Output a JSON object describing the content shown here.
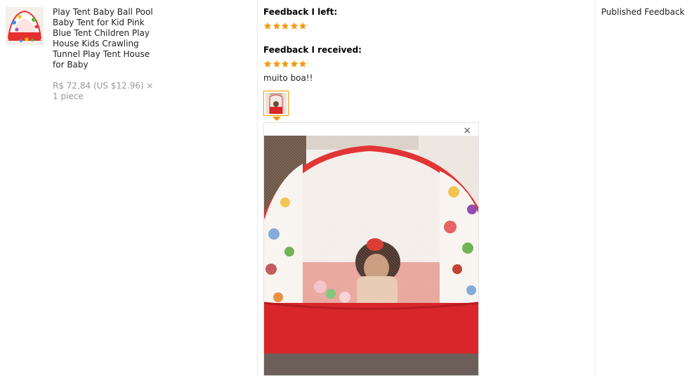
{
  "product": {
    "title": "Play Tent Baby Ball Pool Baby Tent for Kid Pink Blue Tent Children Play House Kids Crawling Tunnel Play Tent House for Baby",
    "price": "R$ 72,84 (US $12.96) × 1 piece",
    "thumbnail_icon": "tent-product-image"
  },
  "feedback": {
    "left_label": "Feedback I left:",
    "left_rating": 5,
    "received_label": "Feedback I received:",
    "received_rating": 5,
    "comment": "muito boa!!",
    "star_color": "#f59a0d",
    "photo_icon": "child-in-tent-photo"
  },
  "viewer": {
    "close_label": "×"
  },
  "status": {
    "text": "Published Feedback"
  },
  "colors": {
    "accent": "#f39800",
    "text": "#222222",
    "muted": "#999999"
  }
}
